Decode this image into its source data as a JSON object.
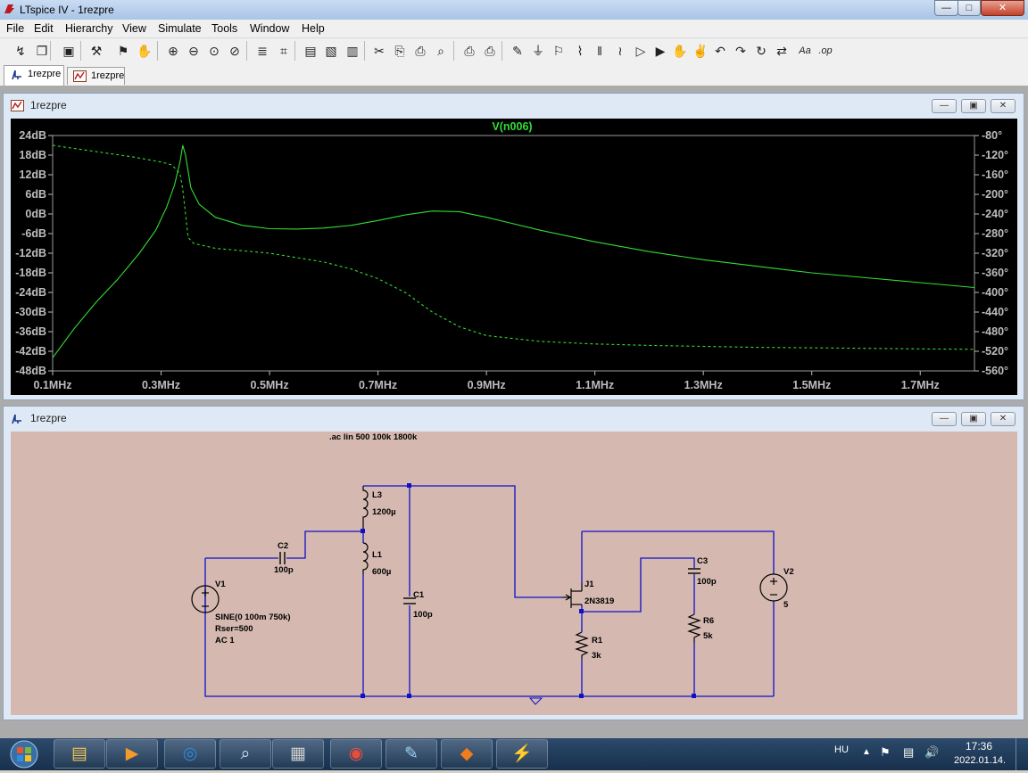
{
  "window": {
    "title": "LTspice IV - 1rezpre",
    "controls": {
      "minimize": "—",
      "maximize": "□",
      "close": "✕"
    }
  },
  "menu": [
    "File",
    "Edit",
    "Hierarchy",
    "View",
    "Simulate",
    "Tools",
    "Window",
    "Help"
  ],
  "toolbar_icons": [
    "new-schematic-icon",
    "open-icon",
    "save-icon",
    "control-panel-icon",
    "run-icon",
    "halt-icon",
    "zoom-in-icon",
    "zoom-out-icon",
    "zoom-fit-icon",
    "zoom-cancel-icon",
    "autorange-icon",
    "grid-icon",
    "tile-horizontal-icon",
    "cascade-icon",
    "tile-vertical-icon",
    "cut-icon",
    "copy-icon",
    "paste-icon",
    "find-icon",
    "print-setup-icon",
    "print-icon",
    "wire-icon",
    "ground-icon",
    "label-icon",
    "resistor-icon",
    "capacitor-icon",
    "inductor-icon",
    "diode-icon",
    "component-icon",
    "move-icon",
    "drag-icon",
    "undo-icon",
    "redo-icon",
    "rotate-icon",
    "mirror-icon",
    "text-icon",
    "spice-directive-icon"
  ],
  "toolbar_glyphs": [
    "↯",
    "❐",
    "▣",
    "⚒",
    "⚑",
    "✋",
    "⊕",
    "⊖",
    "⊙",
    "⊘",
    "≣",
    "⌗",
    "▤",
    "▧",
    "▥",
    "✂",
    "⎘",
    "⎙",
    "⌕",
    "⎙",
    "⎙",
    "✎",
    "⏚",
    "⚐",
    "⌇",
    "‖",
    "≀",
    "▷",
    "▶",
    "✋",
    "✌",
    "↶",
    "↷",
    "↻",
    "⇄",
    "Aa",
    ".op"
  ],
  "tabs": [
    {
      "label": "1rezpre",
      "kind": "schematic",
      "active": true
    },
    {
      "label": "1rezpre",
      "kind": "waveform",
      "active": false
    }
  ],
  "plot_window": {
    "title": "1rezpre"
  },
  "schematic_window": {
    "title": "1rezpre"
  },
  "colors": {
    "plot_bg": "#000000",
    "trace": "#33dd33",
    "schematic_bg": "#d5b9b0",
    "wire": "#1010c8"
  },
  "chart_data": {
    "type": "line",
    "title": "V(n006)",
    "x_ticks": [
      "0.1MHz",
      "0.3MHz",
      "0.5MHz",
      "0.7MHz",
      "0.9MHz",
      "1.1MHz",
      "1.3MHz",
      "1.5MHz",
      "1.7MHz"
    ],
    "y_left_ticks": [
      "24dB",
      "18dB",
      "12dB",
      "6dB",
      "0dB",
      "-6dB",
      "-12dB",
      "-18dB",
      "-24dB",
      "-30dB",
      "-36dB",
      "-42dB",
      "-48dB"
    ],
    "y_right_ticks": [
      "-80°",
      "-120°",
      "-160°",
      "-200°",
      "-240°",
      "-280°",
      "-320°",
      "-360°",
      "-400°",
      "-440°",
      "-480°",
      "-520°",
      "-560°"
    ],
    "xlim_mhz": [
      0.1,
      1.8
    ],
    "ylim_db": [
      -48,
      24
    ],
    "ylim_deg": [
      -560,
      -80
    ],
    "series": [
      {
        "name": "magnitude",
        "style": "solid",
        "axis": "left",
        "x": [
          0.1,
          0.14,
          0.18,
          0.22,
          0.26,
          0.29,
          0.31,
          0.325,
          0.335,
          0.34,
          0.345,
          0.355,
          0.37,
          0.4,
          0.45,
          0.5,
          0.55,
          0.6,
          0.65,
          0.7,
          0.75,
          0.8,
          0.85,
          0.9,
          0.95,
          1.0,
          1.1,
          1.2,
          1.3,
          1.4,
          1.5,
          1.6,
          1.7,
          1.8
        ],
        "y": [
          -44,
          -35,
          -27,
          -20,
          -12,
          -5,
          2,
          9,
          16,
          21,
          18,
          8,
          3,
          -1,
          -3.5,
          -4.5,
          -4.6,
          -4.3,
          -3.5,
          -2,
          -0.3,
          0.9,
          0.7,
          -1,
          -3,
          -5,
          -8.5,
          -11.5,
          -14,
          -16,
          -18,
          -19.5,
          -21,
          -22.5
        ]
      },
      {
        "name": "phase",
        "style": "dashed",
        "axis": "right",
        "x": [
          0.1,
          0.15,
          0.2,
          0.25,
          0.3,
          0.32,
          0.335,
          0.34,
          0.345,
          0.35,
          0.36,
          0.4,
          0.5,
          0.6,
          0.65,
          0.7,
          0.75,
          0.8,
          0.85,
          0.9,
          1.0,
          1.1,
          1.2,
          1.3,
          1.4,
          1.5,
          1.6,
          1.7,
          1.8
        ],
        "y": [
          -100,
          -108,
          -116,
          -124,
          -134,
          -140,
          -158,
          -190,
          -240,
          -288,
          -300,
          -310,
          -320,
          -338,
          -352,
          -372,
          -400,
          -440,
          -470,
          -488,
          -500,
          -505,
          -508,
          -510,
          -512,
          -513,
          -514,
          -515,
          -516
        ]
      }
    ]
  },
  "schematic": {
    "directive": ".ac lin 500 100k 1800k",
    "labels": [
      {
        "id": "L3-ref",
        "text": "L3"
      },
      {
        "id": "L3-val",
        "text": "1200µ"
      },
      {
        "id": "L1-ref",
        "text": "L1"
      },
      {
        "id": "L1-val",
        "text": "600µ"
      },
      {
        "id": "C2-ref",
        "text": "C2"
      },
      {
        "id": "C2-val",
        "text": "100p"
      },
      {
        "id": "C1-ref",
        "text": "C1"
      },
      {
        "id": "C1-val",
        "text": "100p"
      },
      {
        "id": "V1-ref",
        "text": "V1"
      },
      {
        "id": "V1-val1",
        "text": "SINE(0 100m 750k)"
      },
      {
        "id": "V1-val2",
        "text": "Rser=500"
      },
      {
        "id": "V1-val3",
        "text": "AC 1"
      },
      {
        "id": "J1-ref",
        "text": "J1"
      },
      {
        "id": "J1-val",
        "text": "2N3819"
      },
      {
        "id": "R1-ref",
        "text": "R1"
      },
      {
        "id": "R1-val",
        "text": "3k"
      },
      {
        "id": "C3-ref",
        "text": "C3"
      },
      {
        "id": "C3-val",
        "text": "100p"
      },
      {
        "id": "R6-ref",
        "text": "R6"
      },
      {
        "id": "R6-val",
        "text": "5k"
      },
      {
        "id": "V2-ref",
        "text": "V2"
      },
      {
        "id": "V2-val",
        "text": "5"
      }
    ]
  },
  "taskbar": {
    "apps": [
      "explorer",
      "media-player",
      "network",
      "search",
      "calculator",
      "chrome",
      "notepad",
      "firefox",
      "ltspice"
    ],
    "language": "HU",
    "time": "17:36",
    "date": "2022.01.14."
  }
}
